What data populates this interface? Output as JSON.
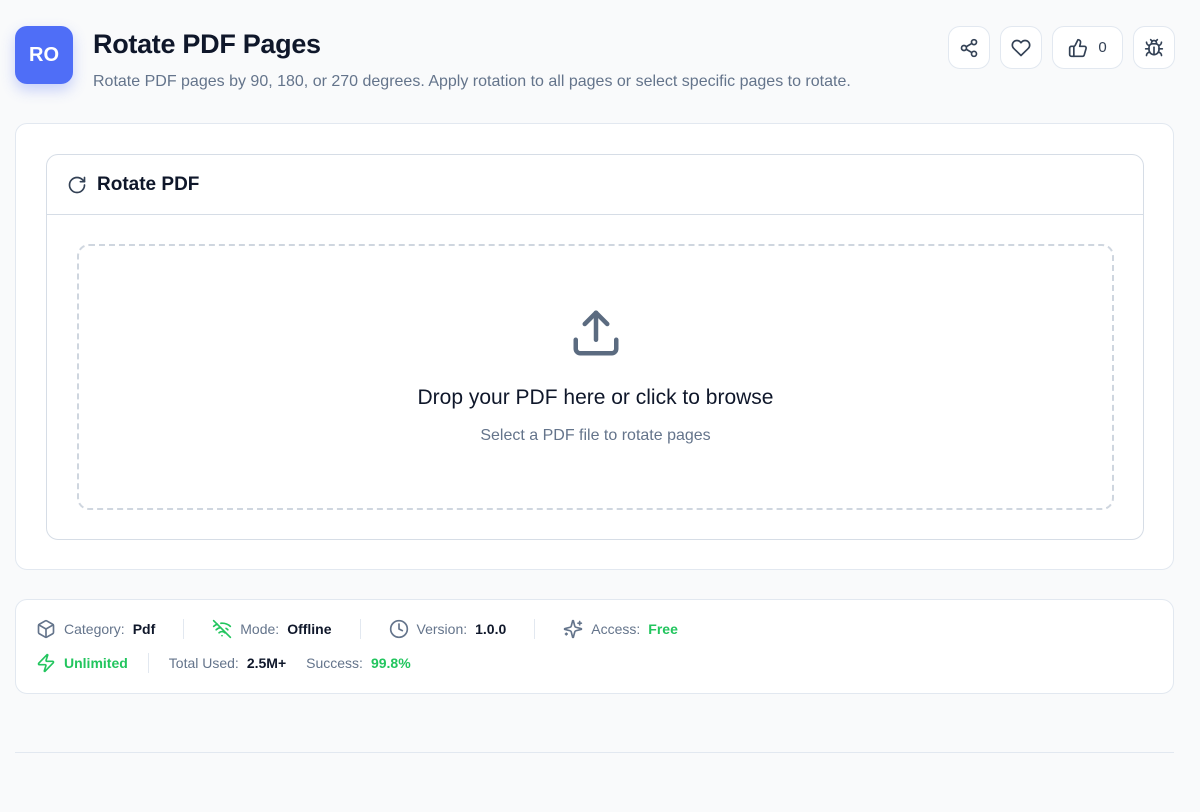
{
  "header": {
    "badge": "RO",
    "title": "Rotate PDF Pages",
    "subtitle": "Rotate PDF pages by 90, 180, or 270 degrees. Apply rotation to all pages or select specific pages to rotate.",
    "actions": {
      "share_icon": "share-icon",
      "favorite_icon": "heart-icon",
      "like_icon": "thumbs-up-icon",
      "like_count": "0",
      "bug_icon": "bug-icon"
    }
  },
  "tool": {
    "title": "Rotate PDF",
    "title_icon": "rotate-icon",
    "dropzone": {
      "icon": "upload-icon",
      "title": "Drop your PDF here or click to browse",
      "subtitle": "Select a PDF file to rotate pages"
    }
  },
  "meta": {
    "category_label": "Category:",
    "category_value": "Pdf",
    "mode_label": "Mode:",
    "mode_value": "Offline",
    "version_label": "Version:",
    "version_value": "1.0.0",
    "access_label": "Access:",
    "access_value": "Free",
    "unlimited": "Unlimited",
    "total_used_label": "Total Used:",
    "total_used_value": "2.5M+",
    "success_label": "Success:",
    "success_value": "99.8%"
  },
  "colors": {
    "brand": "#4f6ef7",
    "accent_green": "#22c55e",
    "text_muted": "#64748b",
    "border": "#e2e8f0"
  }
}
